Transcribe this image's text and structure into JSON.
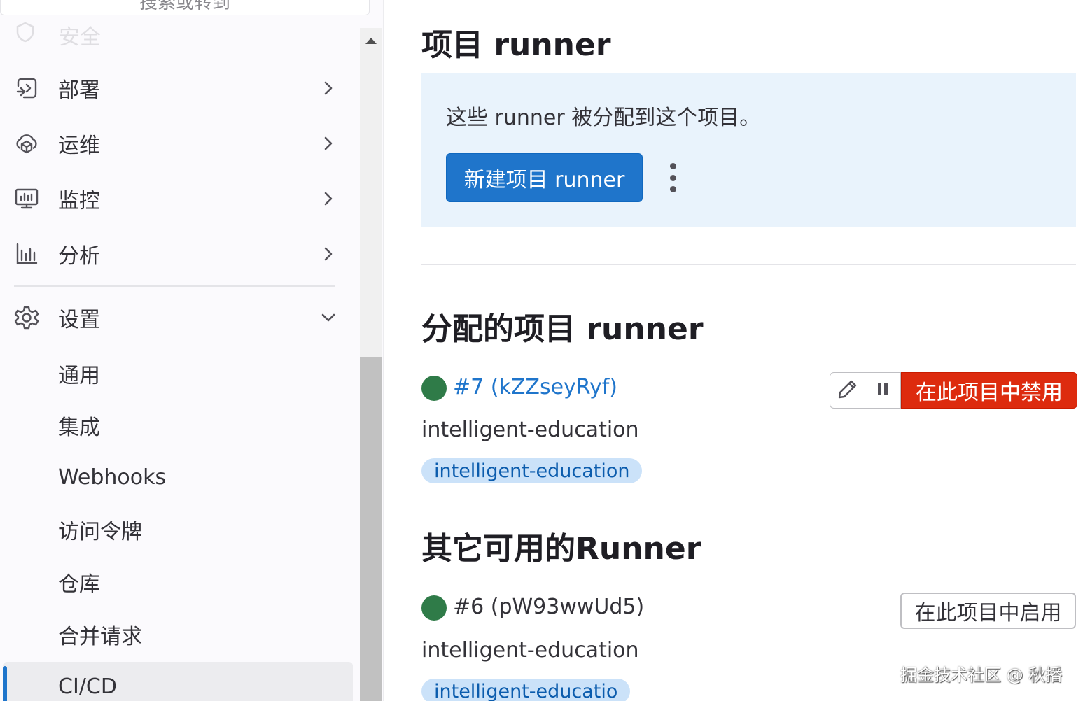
{
  "sidebar": {
    "search_label": "搜索或转到",
    "partial_item": "安全",
    "items": [
      {
        "label": "部署",
        "icon": "deploy-icon"
      },
      {
        "label": "运维",
        "icon": "operate-icon"
      },
      {
        "label": "监控",
        "icon": "monitor-icon"
      },
      {
        "label": "分析",
        "icon": "analytics-icon"
      },
      {
        "label": "设置",
        "icon": "settings-icon"
      }
    ],
    "settings_sub": [
      {
        "label": "通用"
      },
      {
        "label": "集成"
      },
      {
        "label": "Webhooks"
      },
      {
        "label": "访问令牌"
      },
      {
        "label": "仓库"
      },
      {
        "label": "合并请求"
      },
      {
        "label": "CI/CD"
      }
    ]
  },
  "main": {
    "title": "项目 runner",
    "info_text": "这些 runner 被分配到这个项目。",
    "new_runner_button": "新建项目 runner",
    "assigned_section": {
      "title": "分配的项目 runner",
      "runner": {
        "link": "#7 (kZZseyRyf)",
        "description": "intelligent-education",
        "tag": "intelligent-education",
        "disable_button": "在此项目中禁用",
        "status_color": "#2f7b48"
      }
    },
    "other_section": {
      "title": "其它可用的Runner",
      "runner": {
        "link": "#6 (pW93wwUd5)",
        "description": "intelligent-education",
        "tag": "intelligent-educatio",
        "enable_button": "在此项目中启用",
        "status_color": "#2f7b48"
      }
    },
    "watermark": "掘金技术社区 @ 秋播"
  },
  "colors": {
    "primary": "#1f75cb",
    "danger": "#dd2b0e",
    "info_bg": "#e9f3fc",
    "tag_bg": "#cbe2f9",
    "online": "#2f7b48"
  }
}
